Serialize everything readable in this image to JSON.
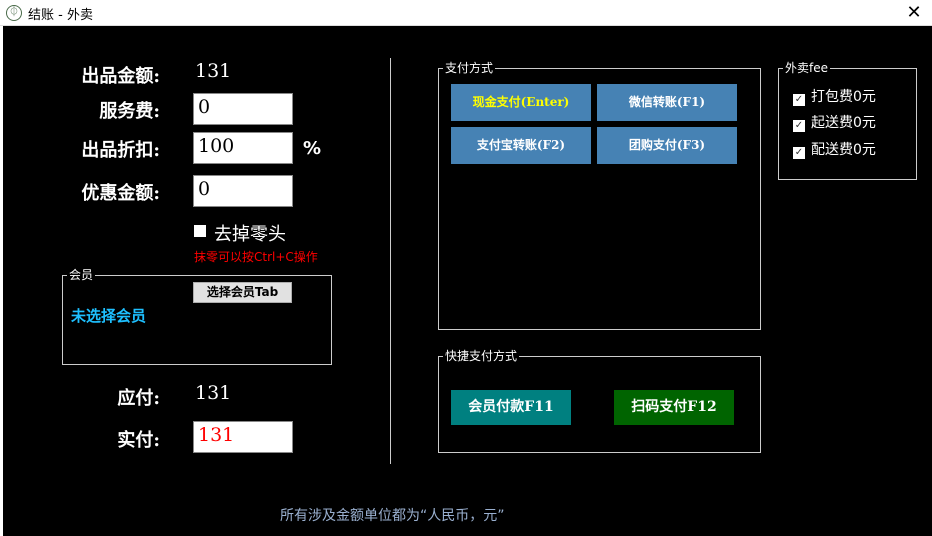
{
  "window": {
    "title": "结账 - 外卖",
    "close": "✕"
  },
  "form": {
    "product_amount_label": "出品金额:",
    "product_amount": "131",
    "service_fee_label": "服务费:",
    "service_fee": "0",
    "discount_label": "出品折扣:",
    "discount": "100",
    "percent": "%",
    "coupon_label": "优惠金额:",
    "coupon": "0",
    "round_off_label": "去掉零头",
    "round_off_hint": "抹零可以按Ctrl+C操作",
    "payable_label": "应付:",
    "payable": "131",
    "paid_label": "实付:",
    "paid": "131"
  },
  "member": {
    "legend": "会员",
    "select_button": "选择会员Tab",
    "status": "未选择会员"
  },
  "payment": {
    "legend": "支付方式",
    "buttons": [
      "现金支付(Enter)",
      "微信转账(F1)",
      "支付宝转账(F2)",
      "团购支付(F3)"
    ]
  },
  "quick": {
    "legend": "快捷支付方式",
    "member_pay": "会员付款F11",
    "scan_pay": "扫码支付F12"
  },
  "fees": {
    "legend": "外卖fee",
    "items": [
      "打包费0元",
      "起送费0元",
      "配送费0元"
    ]
  },
  "footer": "所有涉及金额单位都为“人民币，元”"
}
